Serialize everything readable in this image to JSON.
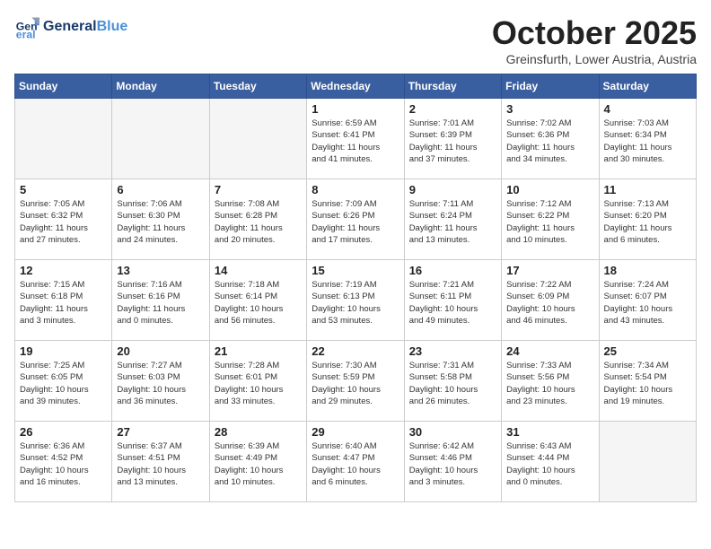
{
  "header": {
    "logo_line1": "General",
    "logo_line2": "Blue",
    "month_title": "October 2025",
    "subtitle": "Greinsfurth, Lower Austria, Austria"
  },
  "weekdays": [
    "Sunday",
    "Monday",
    "Tuesday",
    "Wednesday",
    "Thursday",
    "Friday",
    "Saturday"
  ],
  "weeks": [
    [
      {
        "day": "",
        "info": ""
      },
      {
        "day": "",
        "info": ""
      },
      {
        "day": "",
        "info": ""
      },
      {
        "day": "1",
        "info": "Sunrise: 6:59 AM\nSunset: 6:41 PM\nDaylight: 11 hours\nand 41 minutes."
      },
      {
        "day": "2",
        "info": "Sunrise: 7:01 AM\nSunset: 6:39 PM\nDaylight: 11 hours\nand 37 minutes."
      },
      {
        "day": "3",
        "info": "Sunrise: 7:02 AM\nSunset: 6:36 PM\nDaylight: 11 hours\nand 34 minutes."
      },
      {
        "day": "4",
        "info": "Sunrise: 7:03 AM\nSunset: 6:34 PM\nDaylight: 11 hours\nand 30 minutes."
      }
    ],
    [
      {
        "day": "5",
        "info": "Sunrise: 7:05 AM\nSunset: 6:32 PM\nDaylight: 11 hours\nand 27 minutes."
      },
      {
        "day": "6",
        "info": "Sunrise: 7:06 AM\nSunset: 6:30 PM\nDaylight: 11 hours\nand 24 minutes."
      },
      {
        "day": "7",
        "info": "Sunrise: 7:08 AM\nSunset: 6:28 PM\nDaylight: 11 hours\nand 20 minutes."
      },
      {
        "day": "8",
        "info": "Sunrise: 7:09 AM\nSunset: 6:26 PM\nDaylight: 11 hours\nand 17 minutes."
      },
      {
        "day": "9",
        "info": "Sunrise: 7:11 AM\nSunset: 6:24 PM\nDaylight: 11 hours\nand 13 minutes."
      },
      {
        "day": "10",
        "info": "Sunrise: 7:12 AM\nSunset: 6:22 PM\nDaylight: 11 hours\nand 10 minutes."
      },
      {
        "day": "11",
        "info": "Sunrise: 7:13 AM\nSunset: 6:20 PM\nDaylight: 11 hours\nand 6 minutes."
      }
    ],
    [
      {
        "day": "12",
        "info": "Sunrise: 7:15 AM\nSunset: 6:18 PM\nDaylight: 11 hours\nand 3 minutes."
      },
      {
        "day": "13",
        "info": "Sunrise: 7:16 AM\nSunset: 6:16 PM\nDaylight: 11 hours\nand 0 minutes."
      },
      {
        "day": "14",
        "info": "Sunrise: 7:18 AM\nSunset: 6:14 PM\nDaylight: 10 hours\nand 56 minutes."
      },
      {
        "day": "15",
        "info": "Sunrise: 7:19 AM\nSunset: 6:13 PM\nDaylight: 10 hours\nand 53 minutes."
      },
      {
        "day": "16",
        "info": "Sunrise: 7:21 AM\nSunset: 6:11 PM\nDaylight: 10 hours\nand 49 minutes."
      },
      {
        "day": "17",
        "info": "Sunrise: 7:22 AM\nSunset: 6:09 PM\nDaylight: 10 hours\nand 46 minutes."
      },
      {
        "day": "18",
        "info": "Sunrise: 7:24 AM\nSunset: 6:07 PM\nDaylight: 10 hours\nand 43 minutes."
      }
    ],
    [
      {
        "day": "19",
        "info": "Sunrise: 7:25 AM\nSunset: 6:05 PM\nDaylight: 10 hours\nand 39 minutes."
      },
      {
        "day": "20",
        "info": "Sunrise: 7:27 AM\nSunset: 6:03 PM\nDaylight: 10 hours\nand 36 minutes."
      },
      {
        "day": "21",
        "info": "Sunrise: 7:28 AM\nSunset: 6:01 PM\nDaylight: 10 hours\nand 33 minutes."
      },
      {
        "day": "22",
        "info": "Sunrise: 7:30 AM\nSunset: 5:59 PM\nDaylight: 10 hours\nand 29 minutes."
      },
      {
        "day": "23",
        "info": "Sunrise: 7:31 AM\nSunset: 5:58 PM\nDaylight: 10 hours\nand 26 minutes."
      },
      {
        "day": "24",
        "info": "Sunrise: 7:33 AM\nSunset: 5:56 PM\nDaylight: 10 hours\nand 23 minutes."
      },
      {
        "day": "25",
        "info": "Sunrise: 7:34 AM\nSunset: 5:54 PM\nDaylight: 10 hours\nand 19 minutes."
      }
    ],
    [
      {
        "day": "26",
        "info": "Sunrise: 6:36 AM\nSunset: 4:52 PM\nDaylight: 10 hours\nand 16 minutes."
      },
      {
        "day": "27",
        "info": "Sunrise: 6:37 AM\nSunset: 4:51 PM\nDaylight: 10 hours\nand 13 minutes."
      },
      {
        "day": "28",
        "info": "Sunrise: 6:39 AM\nSunset: 4:49 PM\nDaylight: 10 hours\nand 10 minutes."
      },
      {
        "day": "29",
        "info": "Sunrise: 6:40 AM\nSunset: 4:47 PM\nDaylight: 10 hours\nand 6 minutes."
      },
      {
        "day": "30",
        "info": "Sunrise: 6:42 AM\nSunset: 4:46 PM\nDaylight: 10 hours\nand 3 minutes."
      },
      {
        "day": "31",
        "info": "Sunrise: 6:43 AM\nSunset: 4:44 PM\nDaylight: 10 hours\nand 0 minutes."
      },
      {
        "day": "",
        "info": ""
      }
    ]
  ]
}
